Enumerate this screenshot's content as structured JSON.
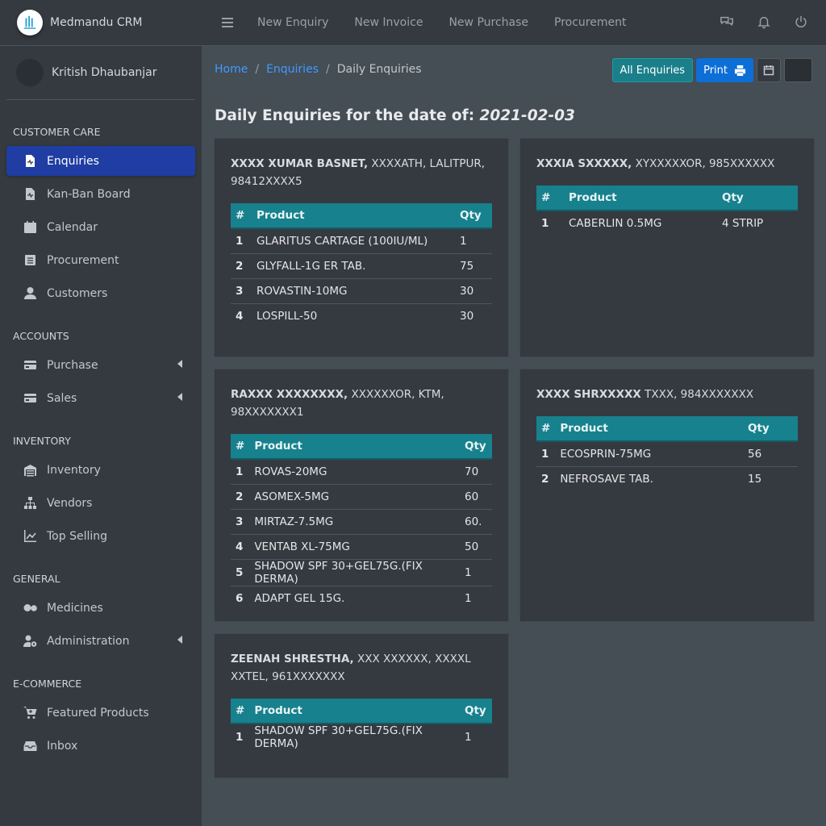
{
  "brand": {
    "name": "Medmandu CRM",
    "logo_icon": "medmandu-logo"
  },
  "user": {
    "name": "Kritish Dhaubanjar"
  },
  "sidebar": {
    "sections": [
      {
        "header": "CUSTOMER CARE",
        "items": [
          {
            "label": "Enquiries",
            "icon": "file-medical-icon",
            "active": true
          },
          {
            "label": "Kan-Ban Board",
            "icon": "file-medical-icon"
          },
          {
            "label": "Calendar",
            "icon": "calendar-icon"
          },
          {
            "label": "Procurement",
            "icon": "list-icon"
          },
          {
            "label": "Customers",
            "icon": "user-icon"
          }
        ]
      },
      {
        "header": "ACCOUNTS",
        "items": [
          {
            "label": "Purchase",
            "icon": "credit-card-icon",
            "expandable": true
          },
          {
            "label": "Sales",
            "icon": "credit-card-icon",
            "expandable": true
          }
        ]
      },
      {
        "header": "INVENTORY",
        "items": [
          {
            "label": "Inventory",
            "icon": "warehouse-icon"
          },
          {
            "label": "Vendors",
            "icon": "sitemap-icon"
          },
          {
            "label": "Top Selling",
            "icon": "chart-line-icon"
          }
        ]
      },
      {
        "header": "GENERAL",
        "items": [
          {
            "label": "Medicines",
            "icon": "pills-icon"
          },
          {
            "label": "Administration",
            "icon": "users-cog-icon",
            "expandable": true
          }
        ]
      },
      {
        "header": "E-COMMERCE",
        "items": [
          {
            "label": "Featured Products",
            "icon": "cart-plus-icon"
          },
          {
            "label": "Inbox",
            "icon": "inbox-icon"
          }
        ]
      }
    ]
  },
  "topbar": {
    "links": [
      "New Enquiry",
      "New Invoice",
      "New Purchase",
      "Procurement"
    ]
  },
  "breadcrumb": {
    "home": "Home",
    "enquiries": "Enquiries",
    "current": "Daily Enquiries",
    "sep": "/"
  },
  "buttons": {
    "all_enquiries": "All Enquiries",
    "print": "Print"
  },
  "page": {
    "title_prefix": "Daily Enquiries for the date of:",
    "date": "2021-02-03"
  },
  "table_headers": {
    "idx": "#",
    "product": "Product",
    "qty": "Qty"
  },
  "cards": [
    {
      "name": "XXXX XUMAR BASNET,",
      "details": "XXXXATH, LALITPUR, 98412XXXX5",
      "rows": [
        [
          "1",
          "GLARITUS CARTAGE (100IU/ML)",
          "1"
        ],
        [
          "2",
          "GLYFALL-1G ER TAB.",
          "75"
        ],
        [
          "3",
          "ROVASTIN-10MG",
          "30"
        ],
        [
          "4",
          "LOSPILL-50",
          "30"
        ]
      ]
    },
    {
      "name": "XXXIA SXXXXX,",
      "details": "XYXXXXXOR, 985XXXXXX",
      "rows": [
        [
          "1",
          "CABERLIN 0.5MG",
          "4 STRIP"
        ]
      ]
    },
    {
      "name": "RAXXX XXXXXXXX,",
      "details": "XXXXXXOR, KTM, 98XXXXXXX1",
      "rows": [
        [
          "1",
          "ROVAS-20MG",
          "70"
        ],
        [
          "2",
          "ASOMEX-5MG",
          "60"
        ],
        [
          "3",
          "MIRTAZ-7.5MG",
          "60."
        ],
        [
          "4",
          "VENTAB XL-75MG",
          "50"
        ],
        [
          "5",
          "SHADOW SPF 30+GEL75G.(FIX DERMA)",
          "1"
        ],
        [
          "6",
          "ADAPT GEL 15G.",
          "1"
        ]
      ]
    },
    {
      "name": "XXXX SHRXXXXX",
      "details": "TXXX, 984XXXXXXX",
      "rows": [
        [
          "1",
          "ECOSPRIN-75MG",
          "56"
        ],
        [
          "2",
          "NEFROSAVE TAB.",
          "15"
        ]
      ]
    },
    {
      "name": "ZEENAH SHRESTHA,",
      "details": "XXX XXXXXX, XXXXL XXTEL, 961XXXXXXX",
      "rows": [
        [
          "1",
          "SHADOW SPF 30+GEL75G.(FIX DERMA)",
          "1"
        ]
      ]
    }
  ]
}
